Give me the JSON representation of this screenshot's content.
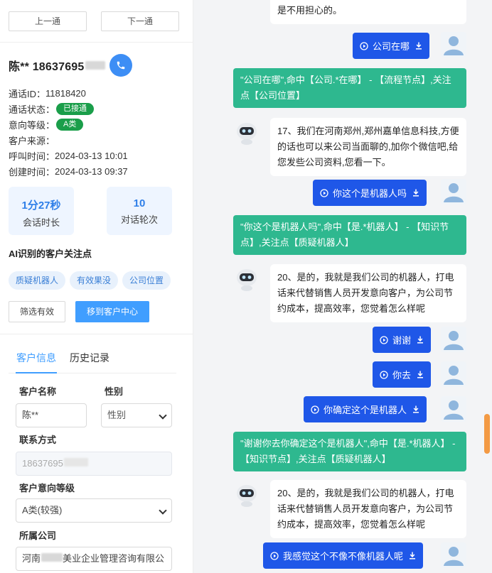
{
  "nav": {
    "prev_label": "上一通",
    "next_label": "下一通"
  },
  "caller": {
    "name": "陈** 18637695"
  },
  "info": [
    {
      "key": "通话ID：",
      "value": "11818420"
    },
    {
      "key": "通话状态：",
      "badge": "已接通"
    },
    {
      "key": "意向等级：",
      "badge": "A类"
    },
    {
      "key": "客户来源：",
      "value": ""
    },
    {
      "key": "呼叫时间：",
      "value": "2024-03-13 10:01"
    },
    {
      "key": "创建时间：",
      "value": "2024-03-13 09:37"
    }
  ],
  "stats": [
    {
      "value": "1分27秒",
      "label": "会话时长"
    },
    {
      "value": "10",
      "label": "对话轮次"
    }
  ],
  "ai_focus": {
    "title": "AI识别的客户关注点",
    "chips": [
      "质疑机器人",
      "有效果没",
      "公司位置"
    ]
  },
  "actions": {
    "filter_label": "筛选有效",
    "move_label": "移到客户中心"
  },
  "tabs": [
    "客户信息",
    "历史记录"
  ],
  "form": {
    "name_label": "客户名称",
    "name_value": "陈**",
    "gender_label": "性别",
    "gender_placeholder": "性别",
    "contact_label": "联系方式",
    "contact_value": "18637695",
    "intent_label": "客户意向等级",
    "intent_value": "A类(较强)",
    "company_label": "所属公司",
    "company_value": "河南",
    "company_value_tail": "美业企业管理咨询有限公"
  },
  "chat": {
    "top_bot_text": "是不用担心的。",
    "messages": [
      {
        "kind": "user",
        "text": "公司在哪"
      },
      {
        "kind": "hit",
        "text": "\"公司在哪\",命中【公司.*在哪】 - 【流程节点】,关注点【公司位置】"
      },
      {
        "kind": "bot",
        "text": "17、我们在河南郑州,郑州嘉单信息科技,方便的话也可以来公司当面聊的,加你个微信吧,给您发些公司资料,您看一下。"
      },
      {
        "kind": "user",
        "text": "你这个是机器人吗"
      },
      {
        "kind": "hit",
        "text": "\"你这个是机器人吗\",命中【是.*机器人】 - 【知识节点】,关注点【质疑机器人】"
      },
      {
        "kind": "bot",
        "text": "20、是的，我就是我们公司的机器人，打电话来代替销售人员开发意向客户，为公司节约成本，提高效率，您觉着怎么样呢"
      },
      {
        "kind": "user",
        "text": "谢谢"
      },
      {
        "kind": "user",
        "text": "你去"
      },
      {
        "kind": "user",
        "text": "你确定这个是机器人"
      },
      {
        "kind": "hit",
        "text": "\"谢谢你去你确定这个是机器人\",命中【是.*机器人】 - 【知识节点】,关注点【质疑机器人】"
      },
      {
        "kind": "bot",
        "text": "20、是的，我就是我们公司的机器人，打电话来代替销售人员开发意向客户，为公司节约成本，提高效率，您觉着怎么样呢"
      },
      {
        "kind": "user",
        "text": "我感觉这个不像不像机器人呢"
      }
    ]
  },
  "colors": {
    "accent": "#409eff",
    "user_bubble": "#1f57e8",
    "hit_bubble": "#2eb88f",
    "status_green": "#1a9e4a",
    "scroll_thumb": "#f39a44"
  }
}
